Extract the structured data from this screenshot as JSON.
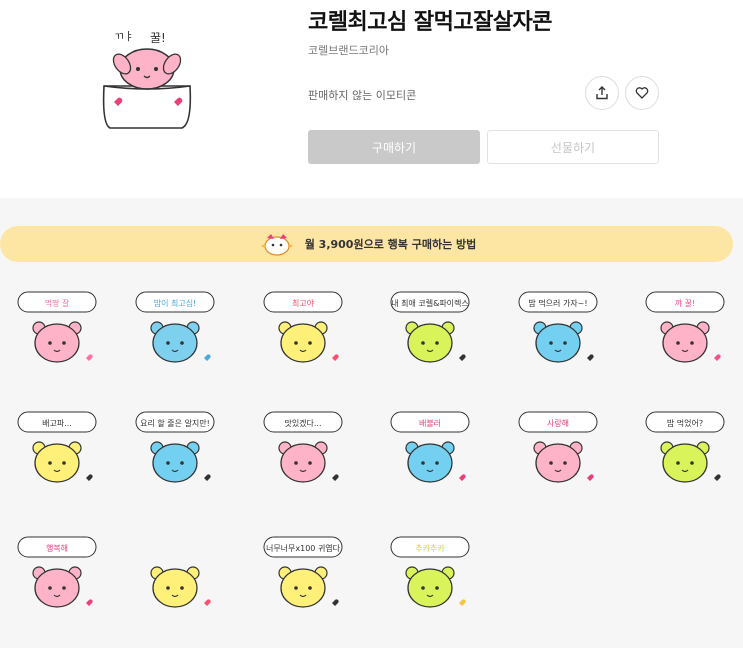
{
  "product": {
    "title": "코렐최고심 잘먹고잘살자콘",
    "brand": "코렐브랜드코리아",
    "status": "판매하지 않는 이모티콘",
    "buy_label": "구매하기",
    "gift_label": "선물하기"
  },
  "banner": {
    "text": "월 3,900원으로 행복 구매하는 방법"
  },
  "stickers": [
    {
      "caption": "먹짱 잘",
      "body": "#ffb3c8",
      "accent": "#ff6fa0"
    },
    {
      "caption": "밥이 최고심!",
      "body": "#7ed0ef",
      "accent": "#4ba8e0"
    },
    {
      "caption": "최고야",
      "body": "#fff07a",
      "accent": "#ff4d6d"
    },
    {
      "caption": "내 최애 코렐&파이렉스",
      "body": "#d9f45a",
      "accent": "#333333"
    },
    {
      "caption": "밥 먹으러 가자~!",
      "body": "#74d0f0",
      "accent": "#333333"
    },
    {
      "caption": "꺄 꿀!",
      "body": "#ffb3c8",
      "accent": "#ff4d8d"
    },
    {
      "caption": "배고파...",
      "body": "#fff07a",
      "accent": "#333333"
    },
    {
      "caption": "요리 할 줄은 알지만!",
      "body": "#74d0f0",
      "accent": "#333333"
    },
    {
      "caption": "맛있겠다...",
      "body": "#ffb3c8",
      "accent": "#333333"
    },
    {
      "caption": "배불러",
      "body": "#74d0f0",
      "accent": "#e8407a"
    },
    {
      "caption": "사랑해",
      "body": "#ffb3c8",
      "accent": "#e8407a"
    },
    {
      "caption": "밥 먹었어?",
      "body": "#d9f45a",
      "accent": "#333333"
    },
    {
      "caption": "행복해",
      "body": "#ffb3c8",
      "accent": "#e8407a"
    },
    {
      "caption": "",
      "body": "#fff07a",
      "accent": "#ff4d6d"
    },
    {
      "caption": "너무너무x100 귀엽다",
      "body": "#fff07a",
      "accent": "#333333"
    },
    {
      "caption": "추카추카",
      "body": "#d9f45a",
      "accent": "#f4c542"
    }
  ],
  "colors": {
    "banner_bg": "#fde6a3",
    "gallery_bg": "#f6f6f6",
    "buy_disabled": "#c9c9c9"
  }
}
